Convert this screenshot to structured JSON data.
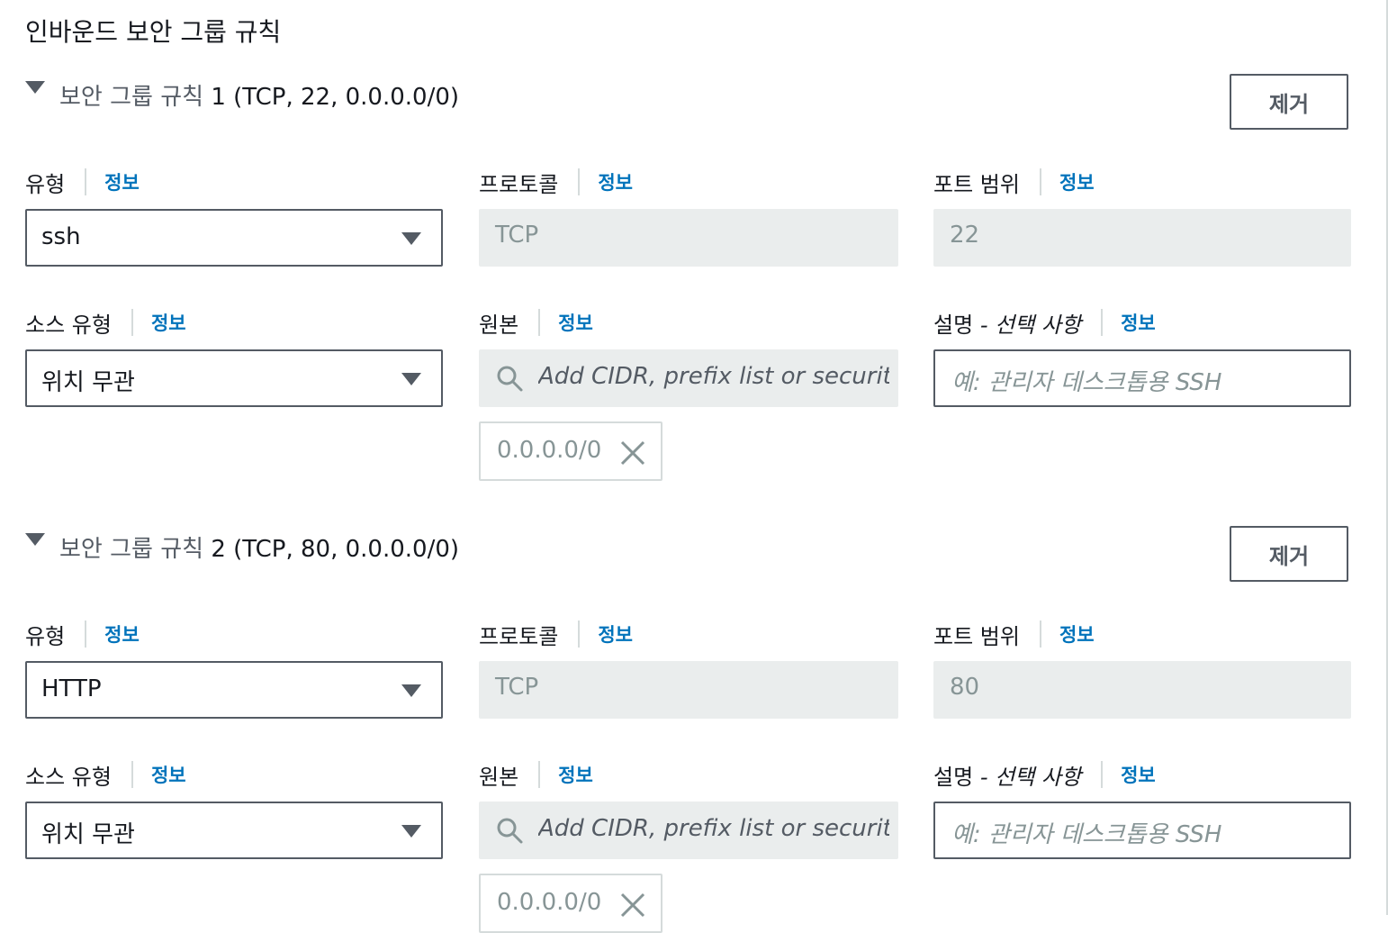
{
  "page": {
    "title": "인바운드 보안 그룹 규칙"
  },
  "rules": [
    {
      "title_prefix": "보안 그룹 규칙",
      "title_suffix": "1 (TCP, 22, 0.0.0.0/0)",
      "remove_label": "제거",
      "type": {
        "label": "유형",
        "info": "정보",
        "value": "ssh"
      },
      "protocol": {
        "label": "프로토콜",
        "info": "정보",
        "value": "TCP"
      },
      "port_range": {
        "label": "포트 범위",
        "info": "정보",
        "value": "22"
      },
      "source_type": {
        "label": "소스 유형",
        "info": "정보",
        "value": "위치 무관"
      },
      "source": {
        "label": "원본",
        "info": "정보",
        "placeholder": "Add CIDR, prefix list or security",
        "token": "0.0.0.0/0"
      },
      "description": {
        "label": "설명",
        "label_optional": "- 선택 사항",
        "info": "정보",
        "placeholder": "예: 관리자 데스크톱용 SSH"
      }
    },
    {
      "title_prefix": "보안 그룹 규칙",
      "title_suffix": "2 (TCP, 80, 0.0.0.0/0)",
      "remove_label": "제거",
      "type": {
        "label": "유형",
        "info": "정보",
        "value": "HTTP"
      },
      "protocol": {
        "label": "프로토콜",
        "info": "정보",
        "value": "TCP"
      },
      "port_range": {
        "label": "포트 범위",
        "info": "정보",
        "value": "80"
      },
      "source_type": {
        "label": "소스 유형",
        "info": "정보",
        "value": "위치 무관"
      },
      "source": {
        "label": "원본",
        "info": "정보",
        "placeholder": "Add CIDR, prefix list or security",
        "token": "0.0.0.0/0"
      },
      "description": {
        "label": "설명",
        "label_optional": "- 선택 사항",
        "info": "정보",
        "placeholder": "예: 관리자 데스크톱용 SSH"
      }
    }
  ],
  "icons": {
    "expand": "caret-down-icon",
    "dropdown": "dropdown-arrow-icon",
    "search": "search-icon",
    "remove_token": "close-icon"
  },
  "colors": {
    "link": "#0073bb",
    "border": "#545b64",
    "readonly_bg": "#eaeded",
    "muted_text": "#879596"
  }
}
